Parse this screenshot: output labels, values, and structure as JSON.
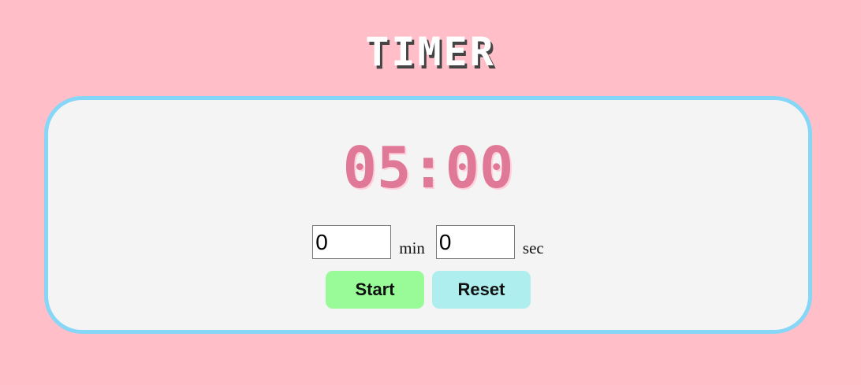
{
  "header": {
    "title": "TIMER"
  },
  "timer": {
    "display": "05:00",
    "minutes_value": "0",
    "minutes_unit": "min",
    "seconds_value": "0",
    "seconds_unit": "sec"
  },
  "actions": {
    "start_label": "Start",
    "reset_label": "Reset"
  },
  "colors": {
    "background": "#ffbec8",
    "card": "#f4f4f4",
    "card_border": "#86d7f7",
    "display_text": "#e07898",
    "start_button": "#98fb98",
    "reset_button": "#afeeee"
  }
}
